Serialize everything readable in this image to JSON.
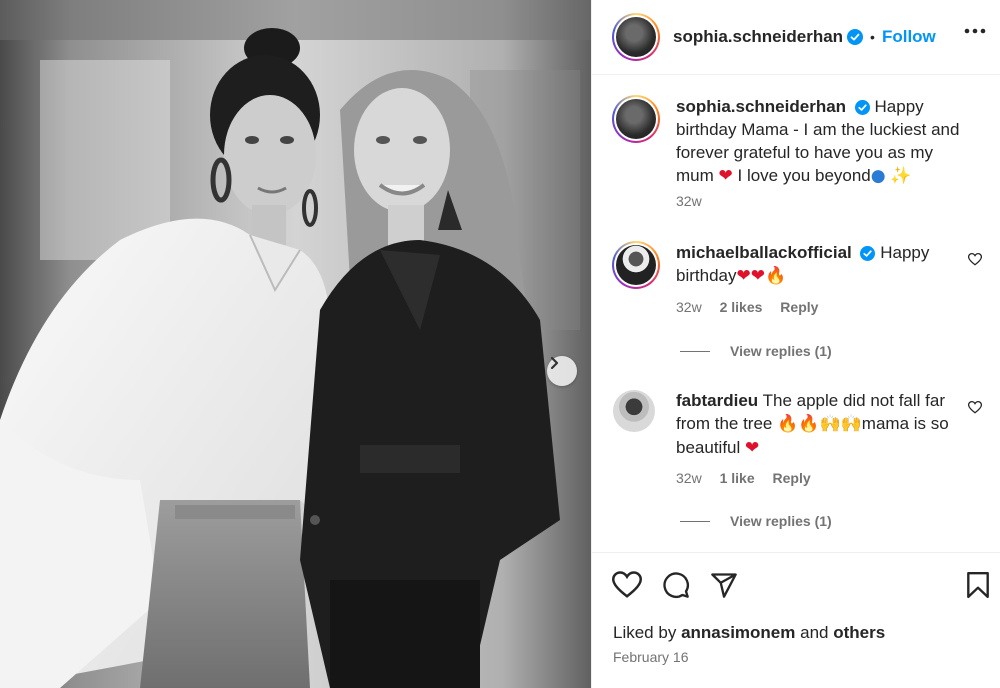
{
  "post": {
    "username": "sophia.schneiderhan",
    "follow_label": "Follow",
    "dot": "•"
  },
  "caption": {
    "username": "sophia.schneiderhan",
    "text_1": "Happy birthday Mama - I am the luckiest and forever grateful to have you as my mum",
    "text_2": "I love you beyond",
    "time": "32w"
  },
  "comments": [
    {
      "username": "michaelballackofficial",
      "verified": true,
      "text": "Happy birthday",
      "emojis": [
        "❤",
        "❤",
        "🔥"
      ],
      "time": "32w",
      "likes": "2 likes",
      "reply": "Reply",
      "view_replies": "View replies (1)"
    },
    {
      "username": "fabtardieu",
      "verified": false,
      "text_1": "The apple did not fall far from the tree",
      "text_2": "mama is so beautiful",
      "time": "32w",
      "likes": "1 like",
      "reply": "Reply",
      "view_replies": "View replies (1)"
    }
  ],
  "footer": {
    "liked_prefix": "Liked by",
    "liked_user": "annasimonem",
    "liked_and": "and",
    "liked_others": "others",
    "date": "February 16"
  },
  "icons": {
    "verified": "verified-badge-icon",
    "more": "more-options-icon",
    "like": "heart-icon",
    "comment": "comment-icon",
    "share": "share-icon",
    "save": "bookmark-icon",
    "next": "chevron-right-icon"
  },
  "colors": {
    "accent": "#0095f6",
    "heart": "#e0112b",
    "muted": "#737373"
  }
}
